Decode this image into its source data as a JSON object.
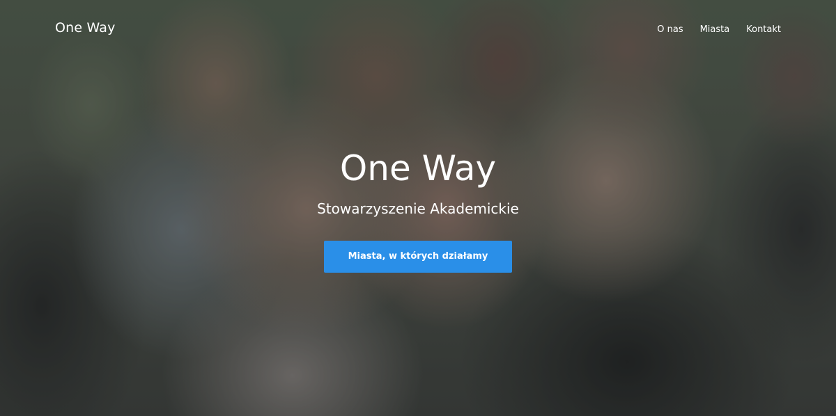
{
  "navbar": {
    "brand": "One Way",
    "links": [
      {
        "label": "O nas"
      },
      {
        "label": "Miasta"
      },
      {
        "label": "Kontakt"
      }
    ]
  },
  "hero": {
    "title": "One Way",
    "subtitle": "Stowarzyszenie Akademickie",
    "cta_label": "Miasta, w których działamy",
    "cta_color": "#2a8fe8"
  }
}
